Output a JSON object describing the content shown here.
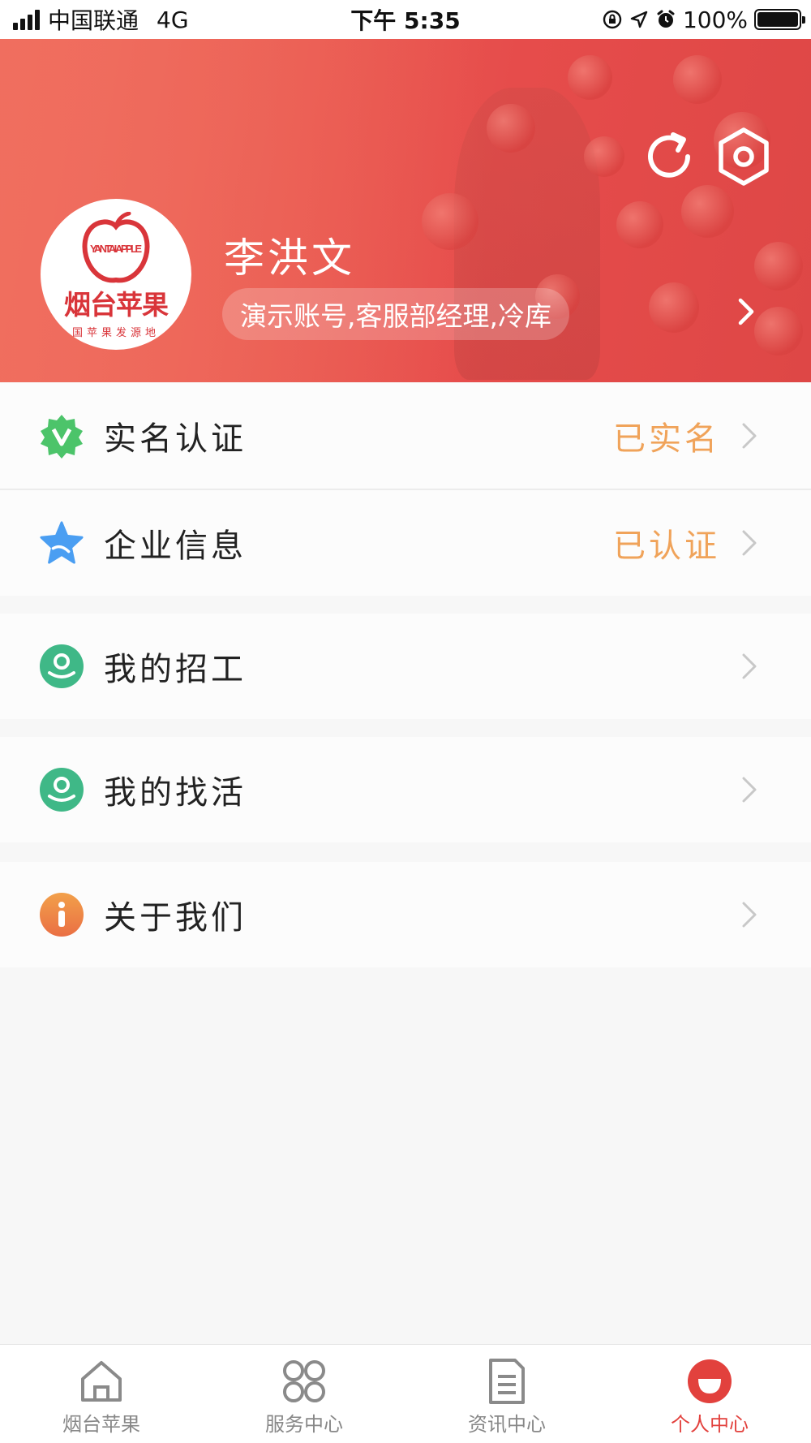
{
  "status_bar": {
    "carrier": "中国联通",
    "network": "4G",
    "time": "下午 5:35",
    "battery": "100%"
  },
  "profile": {
    "name": "李洪文",
    "tags": "演示账号,客服部经理,冷库",
    "avatar_logo": {
      "badge_text": "YANTAI APPLE",
      "title": "烟台苹果",
      "subtitle": "国苹果发源地"
    }
  },
  "header_actions": {
    "refresh_icon": "refresh-icon",
    "settings_icon": "hexagon-settings-icon"
  },
  "menu": [
    {
      "label": "实名认证",
      "status": "已实名",
      "icon": "verified-badge-icon",
      "icon_color": "#4cc46a"
    },
    {
      "label": "企业信息",
      "status": "已认证",
      "icon": "star-icon",
      "icon_color": "#4a9ef2"
    },
    {
      "label": "我的招工",
      "status": "",
      "icon": "worker-icon",
      "icon_color": "#3fb887"
    },
    {
      "label": "我的找活",
      "status": "",
      "icon": "worker-icon",
      "icon_color": "#3fb887"
    },
    {
      "label": "关于我们",
      "status": "",
      "icon": "info-icon",
      "icon_color": "#ef8a4a"
    }
  ],
  "tabs": [
    {
      "label": "烟台苹果",
      "icon": "home-icon",
      "active": false
    },
    {
      "label": "服务中心",
      "icon": "grid-icon",
      "active": false
    },
    {
      "label": "资讯中心",
      "icon": "document-icon",
      "active": false
    },
    {
      "label": "个人中心",
      "icon": "profile-face-icon",
      "active": true
    }
  ],
  "colors": {
    "header_red": "#e64c4b",
    "status_orange": "#f0a35a",
    "active_tab": "#e2413d"
  }
}
